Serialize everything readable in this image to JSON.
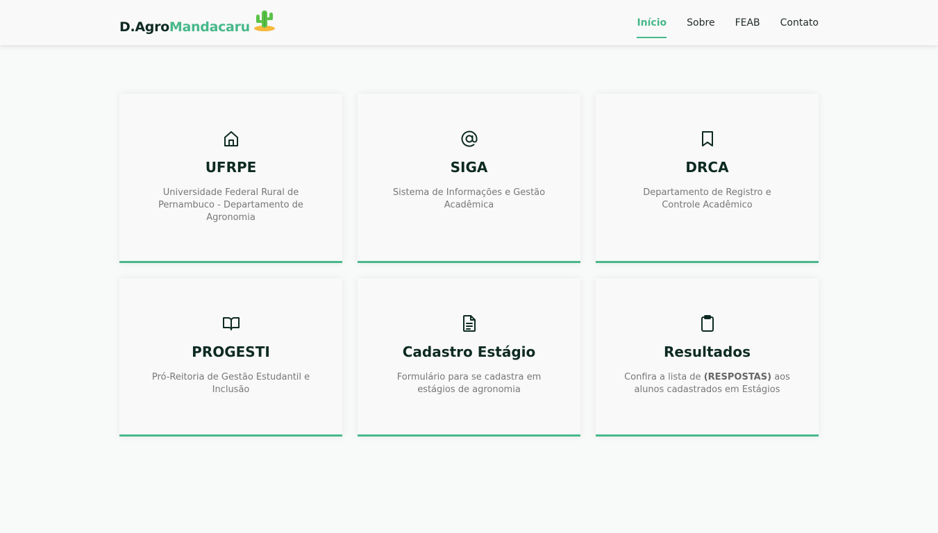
{
  "header": {
    "logo_part1": "D.Agro",
    "logo_part2": "Mandacaru",
    "logo_icon": "cactus-icon"
  },
  "nav": {
    "items": [
      {
        "label": "Início",
        "active": true
      },
      {
        "label": "Sobre",
        "active": false
      },
      {
        "label": "FEAB",
        "active": false
      },
      {
        "label": "Contato",
        "active": false
      }
    ]
  },
  "cards": [
    {
      "icon": "home-icon",
      "title": "UFRPE",
      "description": "Universidade Federal Rural de Pernambuco - Departamento de Agronomia"
    },
    {
      "icon": "at-sign-icon",
      "title": "SIGA",
      "description": "Sistema de Informações e Gestão Acadêmica"
    },
    {
      "icon": "bookmark-icon",
      "title": "DRCA",
      "description": "Departamento de Registro e Controle Acadêmico"
    },
    {
      "icon": "book-open-icon",
      "title": "PROGESTI",
      "description": "Pró-Reitoria de Gestão Estudantil e Inclusão"
    },
    {
      "icon": "file-text-icon",
      "title": "Cadastro Estágio",
      "description": "Formulário para se cadastra em estágios de agronomia"
    },
    {
      "icon": "clipboard-icon",
      "title": "Resultados",
      "description_pre": "Confira a lista de ",
      "description_bold": "(RESPOSTAS)",
      "description_post": " aos alunos cadastrados em Estágios"
    }
  ],
  "colors": {
    "accent": "#47b88a",
    "heading": "#0d2a22",
    "text_muted": "#777777",
    "background": "#f8f9f9"
  }
}
